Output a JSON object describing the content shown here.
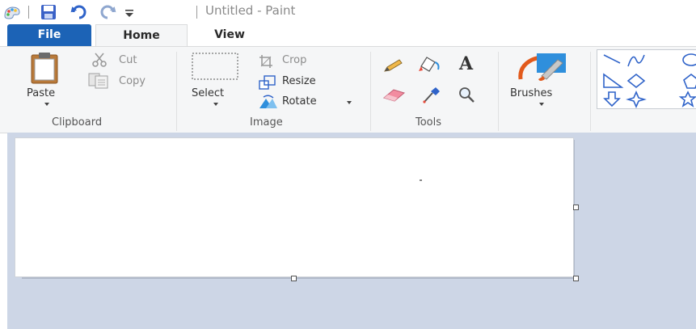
{
  "window": {
    "title": "Untitled - Paint"
  },
  "quick_access": {
    "icons": [
      "paint-app-icon",
      "save-icon",
      "undo-icon",
      "redo-icon",
      "customize-dropdown-icon"
    ]
  },
  "tabs": [
    {
      "label": "File",
      "active": false
    },
    {
      "label": "Home",
      "active": true
    },
    {
      "label": "View",
      "active": false
    }
  ],
  "ribbon": {
    "clipboard": {
      "label": "Clipboard",
      "paste": "Paste",
      "cut": "Cut",
      "copy": "Copy"
    },
    "image": {
      "label": "Image",
      "select": "Select",
      "crop": "Crop",
      "resize": "Resize",
      "rotate": "Rotate"
    },
    "tools": {
      "label": "Tools",
      "icons": [
        "pencil-icon",
        "fill-icon",
        "text-icon",
        "eraser-icon",
        "color-picker-icon",
        "magnifier-icon"
      ]
    },
    "brushes": {
      "label": "Brushes"
    },
    "shapes": {
      "icons": [
        "line-shape-icon",
        "curve-shape-icon",
        "oval-shape-icon",
        "triangle-shape-icon",
        "diamond-shape-icon",
        "pentagon-shape-icon",
        "down-arrow-shape-icon",
        "four-point-star-shape-icon",
        "five-point-star-shape-icon"
      ]
    }
  },
  "colors": {
    "file_tab": "#1c63b6",
    "ribbon_bg": "#f5f6f7",
    "workspace_bg": "#cdd6e6",
    "canvas_bg": "#ffffff"
  }
}
